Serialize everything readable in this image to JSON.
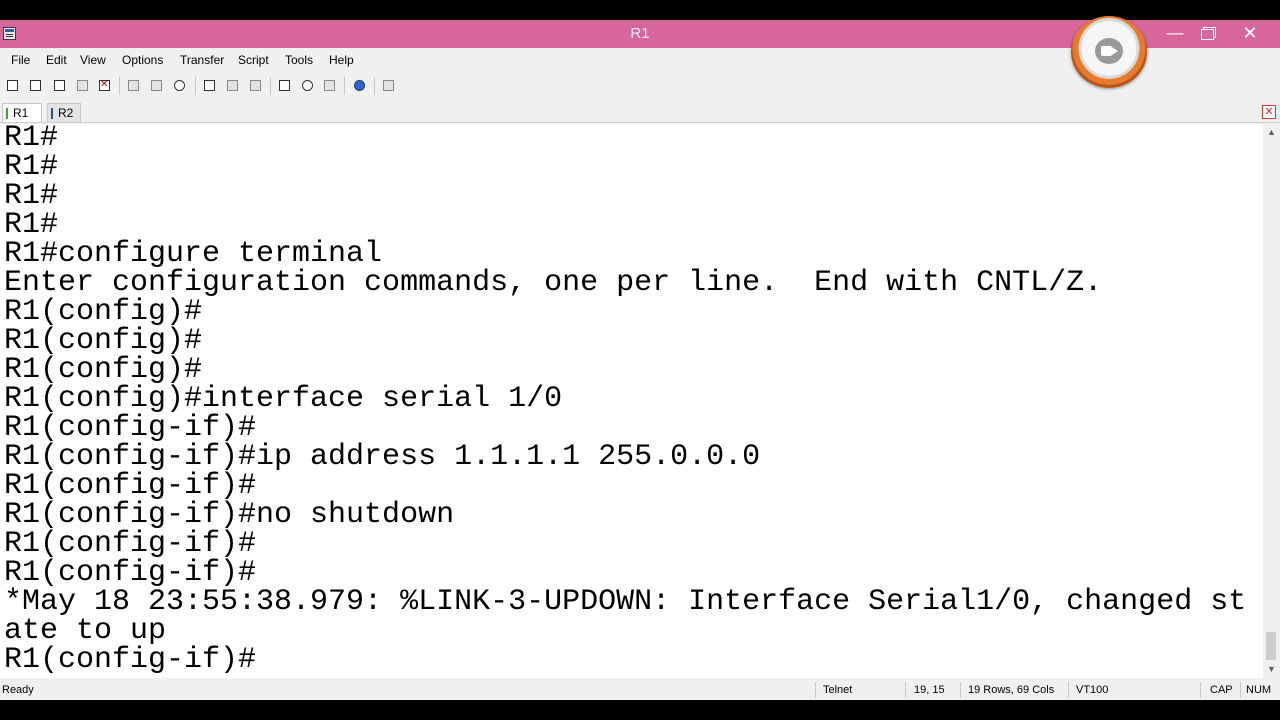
{
  "window": {
    "title": "R1",
    "controls": {
      "minimize": "—",
      "maximize": "",
      "close": "✕"
    }
  },
  "menu": [
    "File",
    "Edit",
    "View",
    "Options",
    "Transfer",
    "Script",
    "Tools",
    "Help"
  ],
  "tabs": [
    {
      "label": "R1",
      "active": true,
      "indicator_color": "#2bb21f"
    },
    {
      "label": "R2",
      "active": false,
      "indicator_color": "#2a4ea5"
    }
  ],
  "terminal": {
    "lines": [
      "R1#",
      "R1#",
      "R1#",
      "R1#",
      "R1#configure terminal",
      "Enter configuration commands, one per line.  End with CNTL/Z.",
      "R1(config)#",
      "R1(config)#",
      "R1(config)#",
      "R1(config)#interface serial 1/0",
      "R1(config-if)#",
      "R1(config-if)#ip address 1.1.1.1 255.0.0.0",
      "R1(config-if)#",
      "R1(config-if)#no shutdown",
      "R1(config-if)#",
      "R1(config-if)#",
      "*May 18 23:55:38.979: %LINK-3-UPDOWN: Interface Serial1/0, changed st",
      "ate to up",
      "R1(config-if)#"
    ]
  },
  "status": {
    "ready": "Ready",
    "protocol": "Telnet",
    "cursor": "19, 15",
    "dimensions": "19 Rows, 69 Cols",
    "emulation": "VT100",
    "caps": "CAP",
    "num": "NUM"
  },
  "colors": {
    "titlebar": "#d7669a",
    "terminal_bg": "#ffffff",
    "terminal_fg": "#000000"
  },
  "icons": {
    "toolbar": [
      "connect-icon",
      "quick-connect-icon",
      "connect-tab-icon",
      "reconnect-icon",
      "disconnect-icon",
      "copy-icon",
      "paste-icon",
      "find-icon",
      "print-icon",
      "print-setup-icon",
      "print-preview-icon",
      "session-options-icon",
      "global-options-icon",
      "keymap-icon",
      "help-icon",
      "customize-icon"
    ]
  }
}
